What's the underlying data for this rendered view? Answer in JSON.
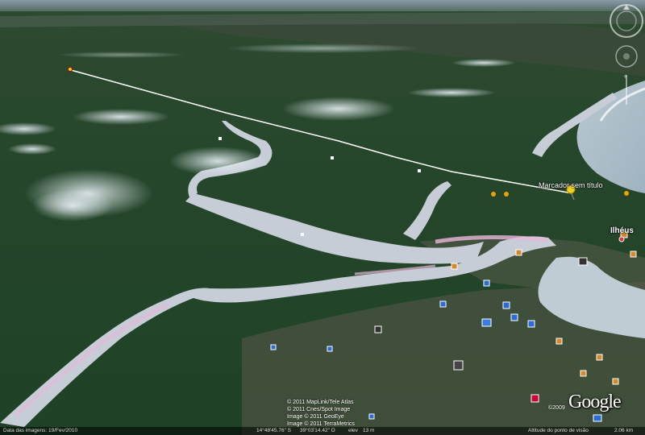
{
  "marker": {
    "label": "Marcador sem título"
  },
  "city": {
    "label": "Ilhéus"
  },
  "credits": {
    "line1": "© 2011 MapLink/Tele Atlas",
    "line2": "© 2011 Cnes/Spot Image",
    "line3": "Image © 2011 GeoEye",
    "line4": "Image © 2011 TerraMetrics"
  },
  "logo": {
    "text": "Google",
    "year": "©2009"
  },
  "status": {
    "imagery_date": "Data das imagens: 19/Fev/2010",
    "latitude": "14°48'45.76\" S",
    "longitude": "39°03'14.42\" O",
    "elev_label": "elev",
    "elevation": "13 m",
    "eye_alt_label": "Altitude do ponto de visão",
    "eye_alt": "2.06 km"
  },
  "nav_controls": {
    "compass_icon": "look-compass-icon",
    "pan_icon": "move-joystick-icon",
    "zoom_icon": "zoom-slider-icon"
  }
}
